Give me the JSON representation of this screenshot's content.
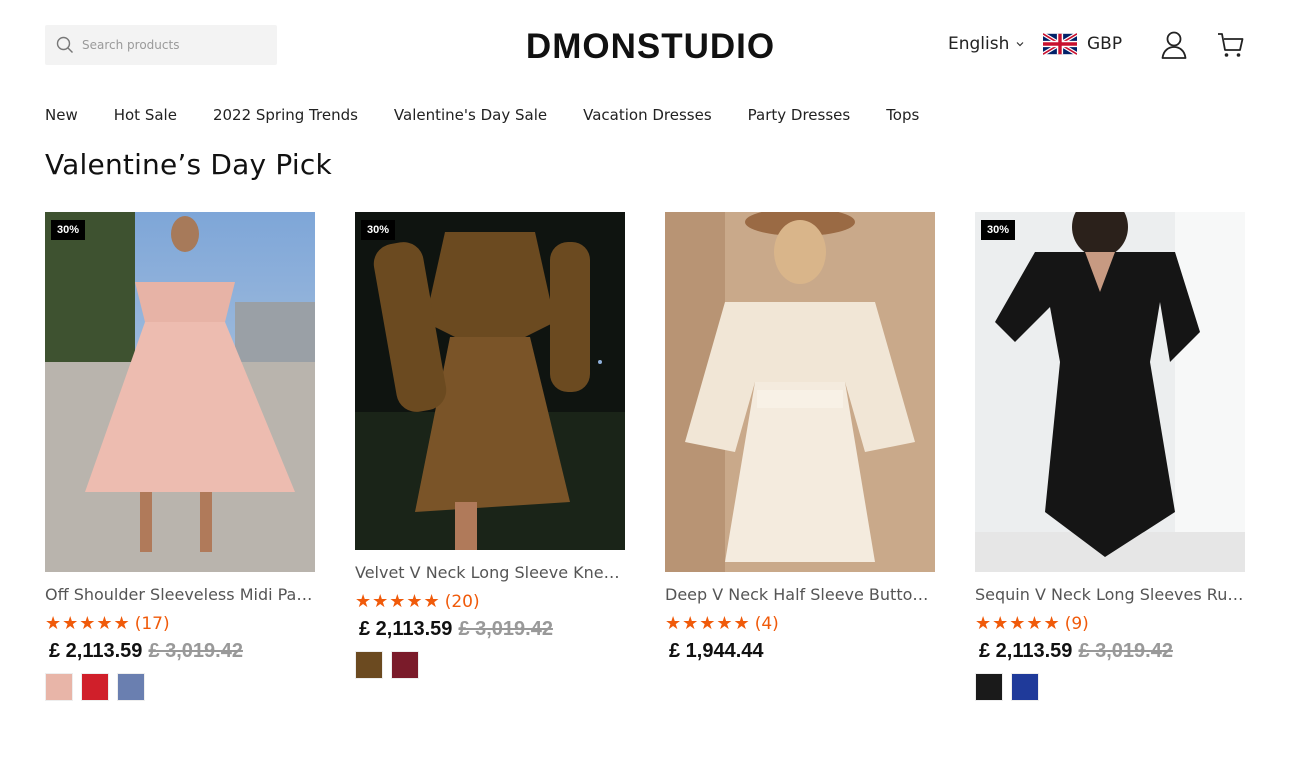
{
  "header": {
    "search_placeholder": "Search products",
    "logo": "DMONSTUDIO",
    "language": "English",
    "currency": "GBP"
  },
  "nav": [
    "New",
    "Hot Sale",
    "2022 Spring Trends",
    "Valentine's Day Sale",
    "Vacation Dresses",
    "Party Dresses",
    "Tops"
  ],
  "section": {
    "title": "Valentine’s Day Pick"
  },
  "products": [
    {
      "badge": "30%",
      "title": "Off Shoulder Sleeveless Midi Party Dress",
      "stars": "★★★★★",
      "reviews": "(17)",
      "price": "£ 2,113.59",
      "old_price": "£ 3,019.42",
      "swatch_colors": [
        "#e8b5a8",
        "#d01f2a",
        "#6a7fb0"
      ]
    },
    {
      "badge": "30%",
      "title": "Velvet V Neck Long Sleeve Knee Length Dress",
      "stars": "★★★★★",
      "reviews": "(20)",
      "price": "£ 2,113.59",
      "old_price": "£ 3,019.42",
      "swatch_colors": [
        "#6b4a20",
        "#7a1b2a"
      ]
    },
    {
      "badge": "",
      "title": "Deep V Neck Half Sleeve Button Lace Dress",
      "stars": "★★★★★",
      "reviews": "(4)",
      "price": "£ 1,944.44",
      "old_price": "",
      "swatch_colors": []
    },
    {
      "badge": "30%",
      "title": "Sequin V Neck Long Sleeves Ruched Dress",
      "stars": "★★★★★",
      "reviews": "(9)",
      "price": "£ 2,113.59",
      "old_price": "£ 3,019.42",
      "swatch_colors": [
        "#1a1a1a",
        "#1f3a9a"
      ]
    }
  ],
  "colors": {
    "accent_star": "#f05a0a",
    "badge_bg": "#000000"
  }
}
